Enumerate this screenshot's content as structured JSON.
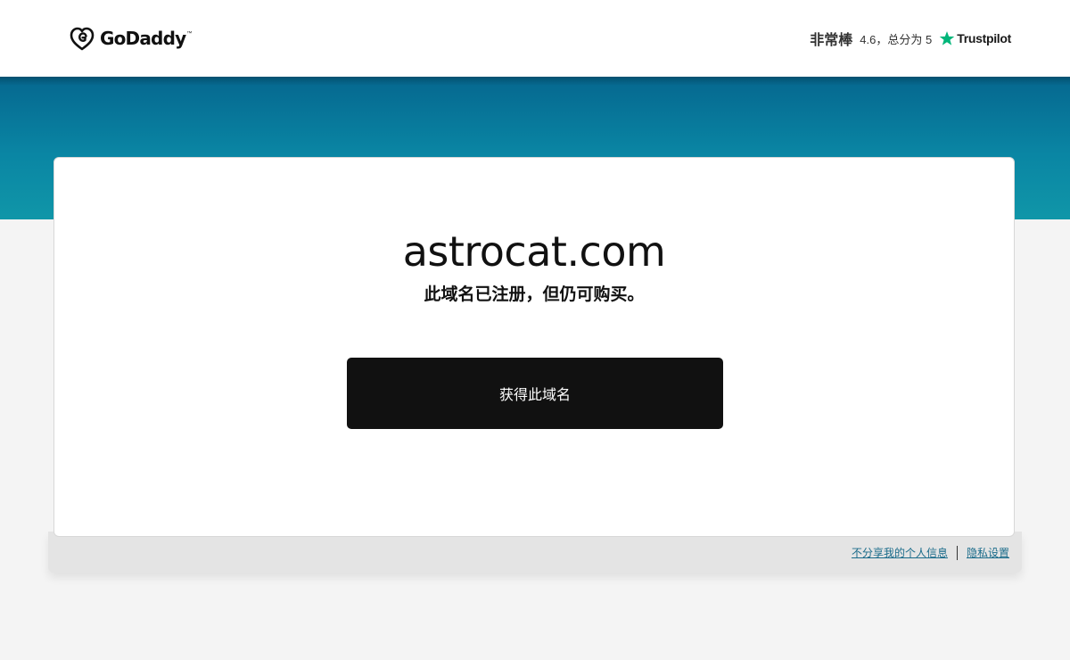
{
  "brand": {
    "name": "GoDaddy",
    "tm": "™",
    "logo_icon": "godaddy-heart-logo-icon"
  },
  "rating": {
    "label": "非常棒",
    "score_text": "4.6，总分为 5",
    "provider": "Trustpilot",
    "star_icon": "trustpilot-star-icon",
    "star_color": "#00b67a"
  },
  "domain": {
    "name": "astrocat.com",
    "status": "此域名已注册，但仍可购买。",
    "cta_label": "获得此域名"
  },
  "footer": {
    "links": [
      "不分享我的个人信息",
      "隐私设置"
    ]
  },
  "colors": {
    "banner_top": "#05678f",
    "banner_bottom": "#1096a8",
    "button_bg": "#111111",
    "link": "#1a6b8a"
  }
}
